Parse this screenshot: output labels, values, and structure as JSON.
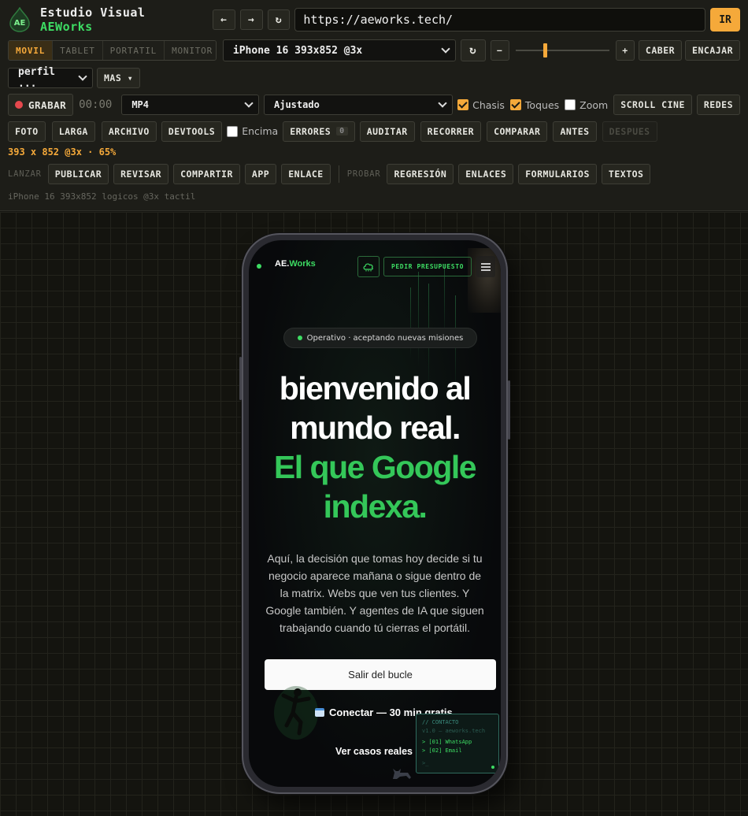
{
  "app": {
    "title_prefix": "Estudio Visual",
    "title_brand": "AEWorks",
    "logo_text": "AE",
    "url": "https://aeworks.tech/",
    "go_label": "IR"
  },
  "devices": {
    "tabs": [
      "MOVIL",
      "TABLET",
      "PORTATIL",
      "MONITOR"
    ],
    "active": "MOVIL",
    "selected_device": "iPhone 16 393x852 @3x",
    "zoom_minus": "−",
    "zoom_plus": "+",
    "zoom_level": 0.3,
    "fit_label": "CABER",
    "fill_label": "ENCAJAR"
  },
  "profile": {
    "selected": "perfil ...",
    "more_label": "MAS ▾"
  },
  "record": {
    "label": "GRABAR",
    "timer": "00:00",
    "format": "MP4",
    "mode": "Ajustado",
    "chasis_label": "Chasis",
    "chasis_on": true,
    "toques_label": "Toques",
    "toques_on": true,
    "zoom_label": "Zoom",
    "zoom_on": false,
    "scroll_label": "SCROLL CINE",
    "social_label": "REDES"
  },
  "tools": {
    "foto": "FOTO",
    "larga": "LARGA",
    "archivo": "ARCHIVO",
    "devtools": "DEVTOOLS",
    "encima_label": "Encima",
    "errores": "ERRORES",
    "errores_count": "0",
    "auditar": "AUDITAR",
    "recorrer": "RECORRER",
    "comparar": "COMPARAR",
    "antes": "ANTES",
    "despues": "DESPUES"
  },
  "dimensions_text": "393 x 852 @3x · 65%",
  "launch": {
    "label": "LANZAR",
    "items": [
      "PUBLICAR",
      "REVISAR",
      "COMPARTIR",
      "APP",
      "ENLACE"
    ]
  },
  "test": {
    "label": "PROBAR",
    "items": [
      "REGRESIÓN",
      "ENLACES",
      "FORMULARIOS",
      "TEXTOS"
    ]
  },
  "device_caption": "iPhone 16 393x852 logicos @3x tactil",
  "site": {
    "logo_prefix": "AE.",
    "logo_suffix": "Works",
    "cta": "PEDIR PRESUPUESTO",
    "status": "Operativo · aceptando nuevas misiones",
    "headline_1": "bienvenido al",
    "headline_2": "mundo real.",
    "headline_3": "El que Google",
    "headline_4": "indexa.",
    "body": "Aquí, la decisión que tomas hoy decide si tu negocio aparece mañana o sigue dentro de la matrix. Webs que ven tus clientes. Y Google también. Y agentes de IA que siguen trabajando cuando tú cierras el portátil.",
    "primary_button": "Salir del bucle",
    "connect": "Conectar — 30 min gratis",
    "cases": "Ver casos reales",
    "terminal_title": "// CONTACTO",
    "terminal_sub": "v1.0 — aeworks.tech",
    "terminal_line_1": "> [01] WhatsApp",
    "terminal_line_2": "> [02] Email",
    "terminal_prompt": ">_"
  },
  "colors": {
    "accent": "#f5a93a",
    "brand_green": "#3ddc63",
    "record_red": "#e5484d"
  }
}
